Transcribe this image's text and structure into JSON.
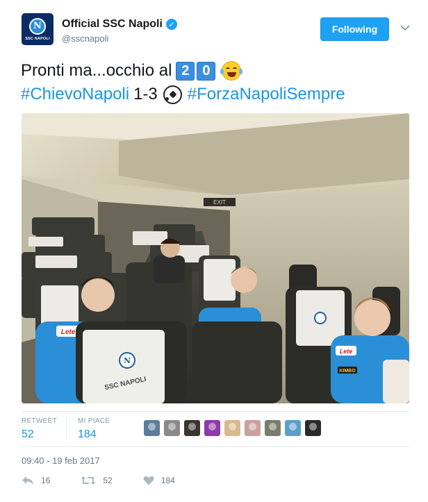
{
  "author": {
    "display_name": "Official SSC Napoli",
    "handle": "@sscnapoli",
    "verified": true,
    "avatar_text": "SSC NAPOLI",
    "avatar_initial": "N"
  },
  "follow_button_label": "Following",
  "tweet": {
    "text_prefix": "Pronti ma...occhio al",
    "keycap_digits": [
      "2",
      "0"
    ],
    "hashtag1": "#ChievoNapoli",
    "score": "1-3",
    "hashtag2": "#ForzaNapoliSempre"
  },
  "media": {
    "exit_sign": "EXIT",
    "seat_logo": "SSC NAPOLI",
    "jersey_sponsor": "Lete",
    "sleeve_sponsor": "KIMBO",
    "headrest_initial": "N"
  },
  "stats": {
    "retweet_label": "RETWEET",
    "retweet_count": "52",
    "likes_label": "MI PIACE",
    "likes_count": "184"
  },
  "likers": [
    {
      "name": "liker-avatar-1",
      "color": "#5b7d9b"
    },
    {
      "name": "liker-avatar-2",
      "color": "#8a8a8a"
    },
    {
      "name": "liker-avatar-3",
      "color": "#3a3530"
    },
    {
      "name": "liker-avatar-4",
      "color": "#8e3aa8"
    },
    {
      "name": "liker-avatar-5",
      "color": "#d9b98c"
    },
    {
      "name": "liker-avatar-6",
      "color": "#c9a0a0"
    },
    {
      "name": "liker-avatar-7",
      "color": "#7a7d6a"
    },
    {
      "name": "liker-avatar-8",
      "color": "#5aa0c8"
    },
    {
      "name": "liker-avatar-9",
      "color": "#2b2b2b"
    }
  ],
  "timestamp": "09:40 - 19 feb 2017",
  "actions": {
    "reply_count": "16",
    "retweet_count": "52",
    "like_count": "184"
  },
  "colors": {
    "brand_blue": "#1da1f2",
    "link_blue": "#1b95e0",
    "napoli_navy": "#0b2b63",
    "jersey_blue": "#2a8fd6"
  }
}
